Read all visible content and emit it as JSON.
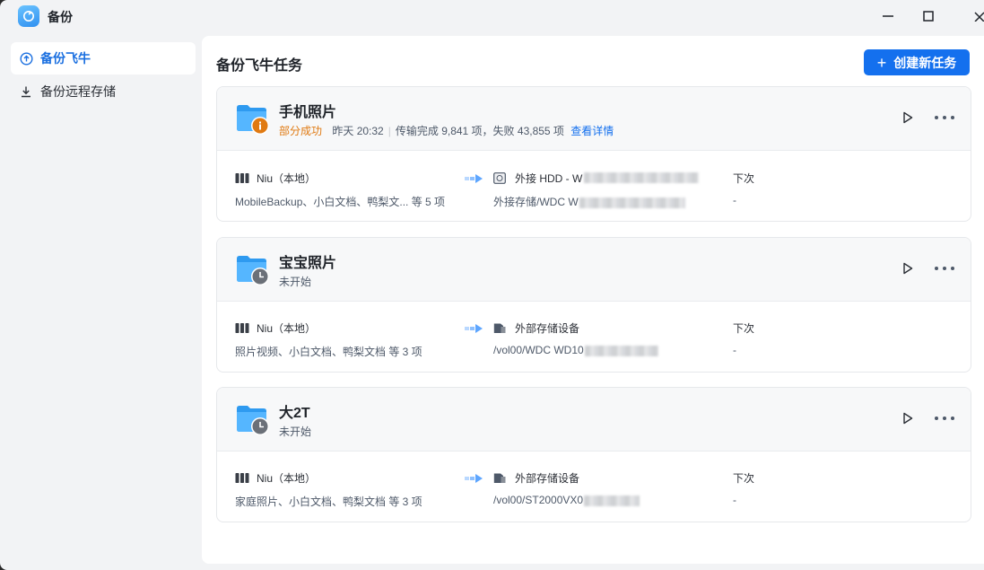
{
  "app": {
    "title": "备份"
  },
  "sidebar": {
    "items": [
      {
        "label": "备份飞牛",
        "icon": "upload-cloud-icon",
        "active": true
      },
      {
        "label": "备份远程存储",
        "icon": "download-icon",
        "active": false
      }
    ]
  },
  "main": {
    "title": "备份飞牛任务",
    "create_label": "创建新任务",
    "accent": "#1470ee"
  },
  "tasks": [
    {
      "name": "手机照片",
      "status": "部分成功",
      "status_badge": "warning",
      "time": "昨天 20:32",
      "summary": "传输完成 9,841 项，失败 43,855 项",
      "details_link": "查看详情",
      "source": {
        "name": "Niu（本地）",
        "folders": "MobileBackup、小白文档、鸭梨文... 等 5 项"
      },
      "target": {
        "name": "外接 HDD - W",
        "path": "外接存储/WDC W",
        "icon": "hdd-icon"
      },
      "next": {
        "label": "下次",
        "value": "-"
      }
    },
    {
      "name": "宝宝照片",
      "status": "未开始",
      "status_badge": "clock",
      "source": {
        "name": "Niu（本地）",
        "folders": "照片视频、小白文档、鸭梨文档 等 3 项"
      },
      "target": {
        "name": "外部存储设备",
        "path": "/vol00/WDC WD10",
        "icon": "external-drive-icon"
      },
      "next": {
        "label": "下次",
        "value": "-"
      }
    },
    {
      "name": "大2T",
      "status": "未开始",
      "status_badge": "clock",
      "source": {
        "name": "Niu（本地）",
        "folders": "家庭照片、小白文档、鸭梨文档 等 3 项"
      },
      "target": {
        "name": "外部存储设备",
        "path": "/vol00/ST2000VX0",
        "icon": "external-drive-icon"
      },
      "next": {
        "label": "下次",
        "value": "-"
      }
    }
  ]
}
